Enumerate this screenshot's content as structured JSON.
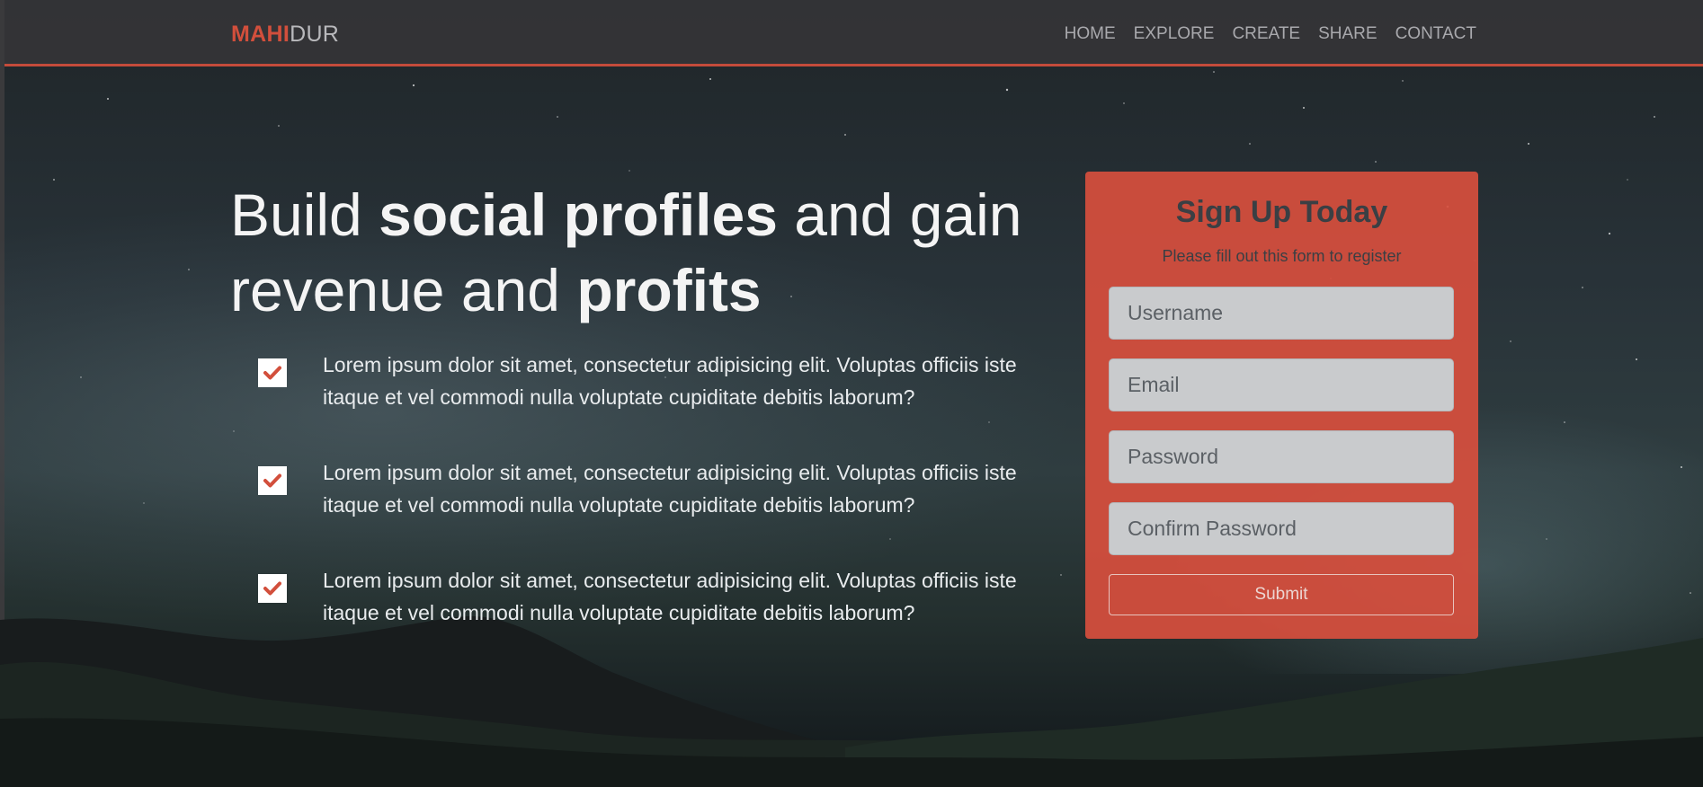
{
  "navbar": {
    "brand_accent": "MAHI",
    "brand_rest": "DUR",
    "links": [
      "HOME",
      "EXPLORE",
      "CREATE",
      "SHARE",
      "CONTACT"
    ]
  },
  "hero": {
    "headline": {
      "p1": "Build ",
      "b1": "social profiles",
      "p2": " and gain revenue and ",
      "b2": "profits"
    },
    "features": [
      {
        "icon": "check-icon",
        "text": "Lorem ipsum dolor sit amet, consectetur adipisicing elit. Voluptas officiis iste itaque et vel commodi nulla voluptate cupiditate debitis laborum?"
      },
      {
        "icon": "check-icon",
        "text": "Lorem ipsum dolor sit amet, consectetur adipisicing elit. Voluptas officiis iste itaque et vel commodi nulla voluptate cupiditate debitis laborum?"
      },
      {
        "icon": "check-icon",
        "text": "Lorem ipsum dolor sit amet, consectetur adipisicing elit. Voluptas officiis iste itaque et vel commodi nulla voluptate cupiditate debitis laborum?"
      }
    ]
  },
  "signup": {
    "title": "Sign Up Today",
    "subtitle": "Please fill out this form to register",
    "fields": {
      "username": {
        "placeholder": "Username",
        "value": ""
      },
      "email": {
        "placeholder": "Email",
        "value": ""
      },
      "password": {
        "placeholder": "Password",
        "value": ""
      },
      "confirm": {
        "placeholder": "Confirm Password",
        "value": ""
      }
    },
    "submit_label": "Submit"
  },
  "colors": {
    "accent": "#d24f3c",
    "card": "#d64f3d",
    "navbar": "#343437"
  }
}
